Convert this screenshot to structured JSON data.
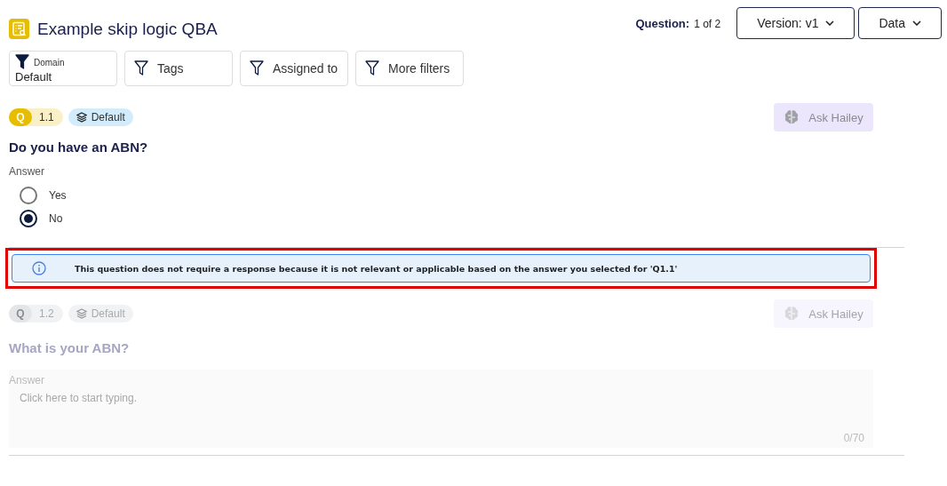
{
  "header": {
    "title": "Example skip logic QBA",
    "question_label": "Question:",
    "question_value": "1 of 2",
    "menus": [
      {
        "label": "Version: v1"
      },
      {
        "label": "Data"
      }
    ]
  },
  "filters": [
    {
      "kind": "domain",
      "label": "Domain",
      "value": "Default"
    },
    {
      "kind": "filter",
      "label": "Tags"
    },
    {
      "kind": "filter",
      "label": "Assigned to"
    },
    {
      "kind": "filter",
      "label": "More filters"
    }
  ],
  "questions": [
    {
      "kind": "radio",
      "disabled": false,
      "badge": "Q",
      "number": "1.1",
      "domain": "Default",
      "ask_button": "Ask Hailey",
      "text": "Do you have an ABN?",
      "answer_label": "Answer",
      "options": [
        {
          "label": "Yes",
          "selected": false
        },
        {
          "label": "No",
          "selected": true
        }
      ]
    },
    {
      "kind": "text",
      "disabled": true,
      "notice": {
        "text": "This question does not require a response because it is not relevant or applicable based on the answer you selected for 'Q1.1'",
        "highlighted": true
      },
      "badge": "Q",
      "number": "1.2",
      "domain": "Default",
      "ask_button": "Ask Hailey",
      "text": "What is your ABN?",
      "answer_label": "Answer",
      "placeholder": "Click here to start typing.",
      "counter": "0/70"
    }
  ]
}
